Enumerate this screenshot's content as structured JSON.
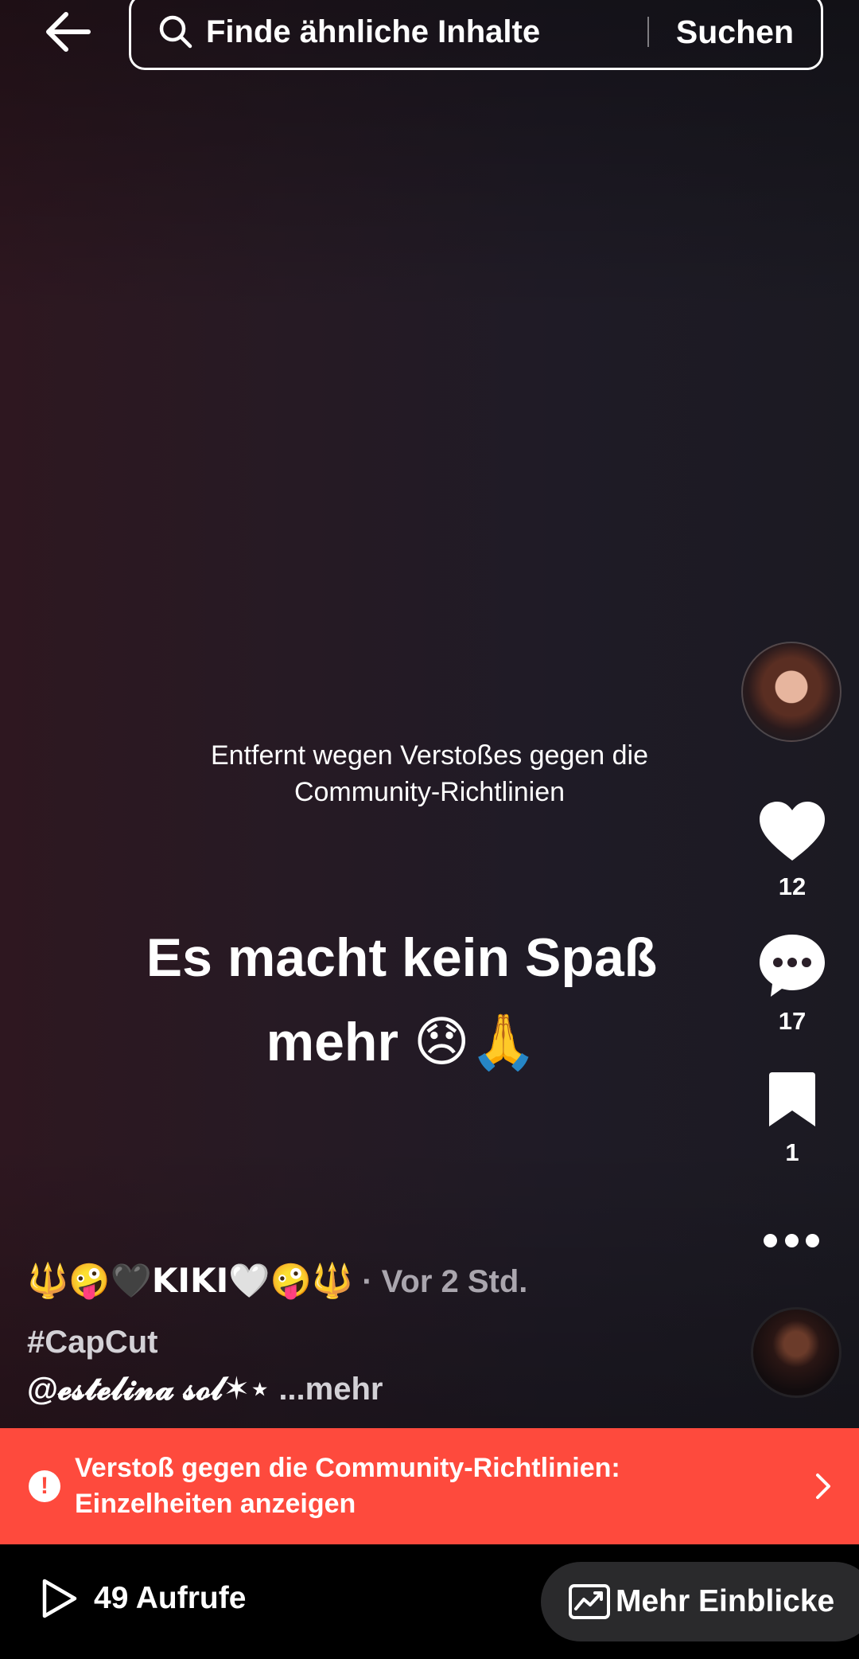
{
  "top_bar": {
    "search_placeholder": "Finde ähnliche Inhalte",
    "search_button": "Suchen"
  },
  "video": {
    "removed_notice": "Entfernt wegen Verstoßes gegen die Community-Richtlinien",
    "caption_line1": "Es macht kein Spaß",
    "caption_line2": "mehr",
    "caption_emojis": "😞🙏"
  },
  "actions": {
    "likes": "12",
    "comments": "17",
    "bookmarks": "1"
  },
  "post": {
    "author": "🔱🤪🖤KIKI🤍🤪🔱",
    "time": " · Vor 2 Std.",
    "hashtag": "#CapCut",
    "mention": "@𝓮𝓼𝓽𝓮𝓵𝓲𝓷𝓪 𝓼𝓸𝓵✶⋆",
    "more": " ...mehr"
  },
  "violation_banner": {
    "text": "Verstoß gegen die Community-Richtlinien: Einzelheiten anzeigen"
  },
  "bottom_bar": {
    "views": "49 Aufrufe",
    "insights": "Mehr Einblicke"
  },
  "colors": {
    "banner": "#fe4a3d",
    "insights_button": "#2a2a2c"
  }
}
